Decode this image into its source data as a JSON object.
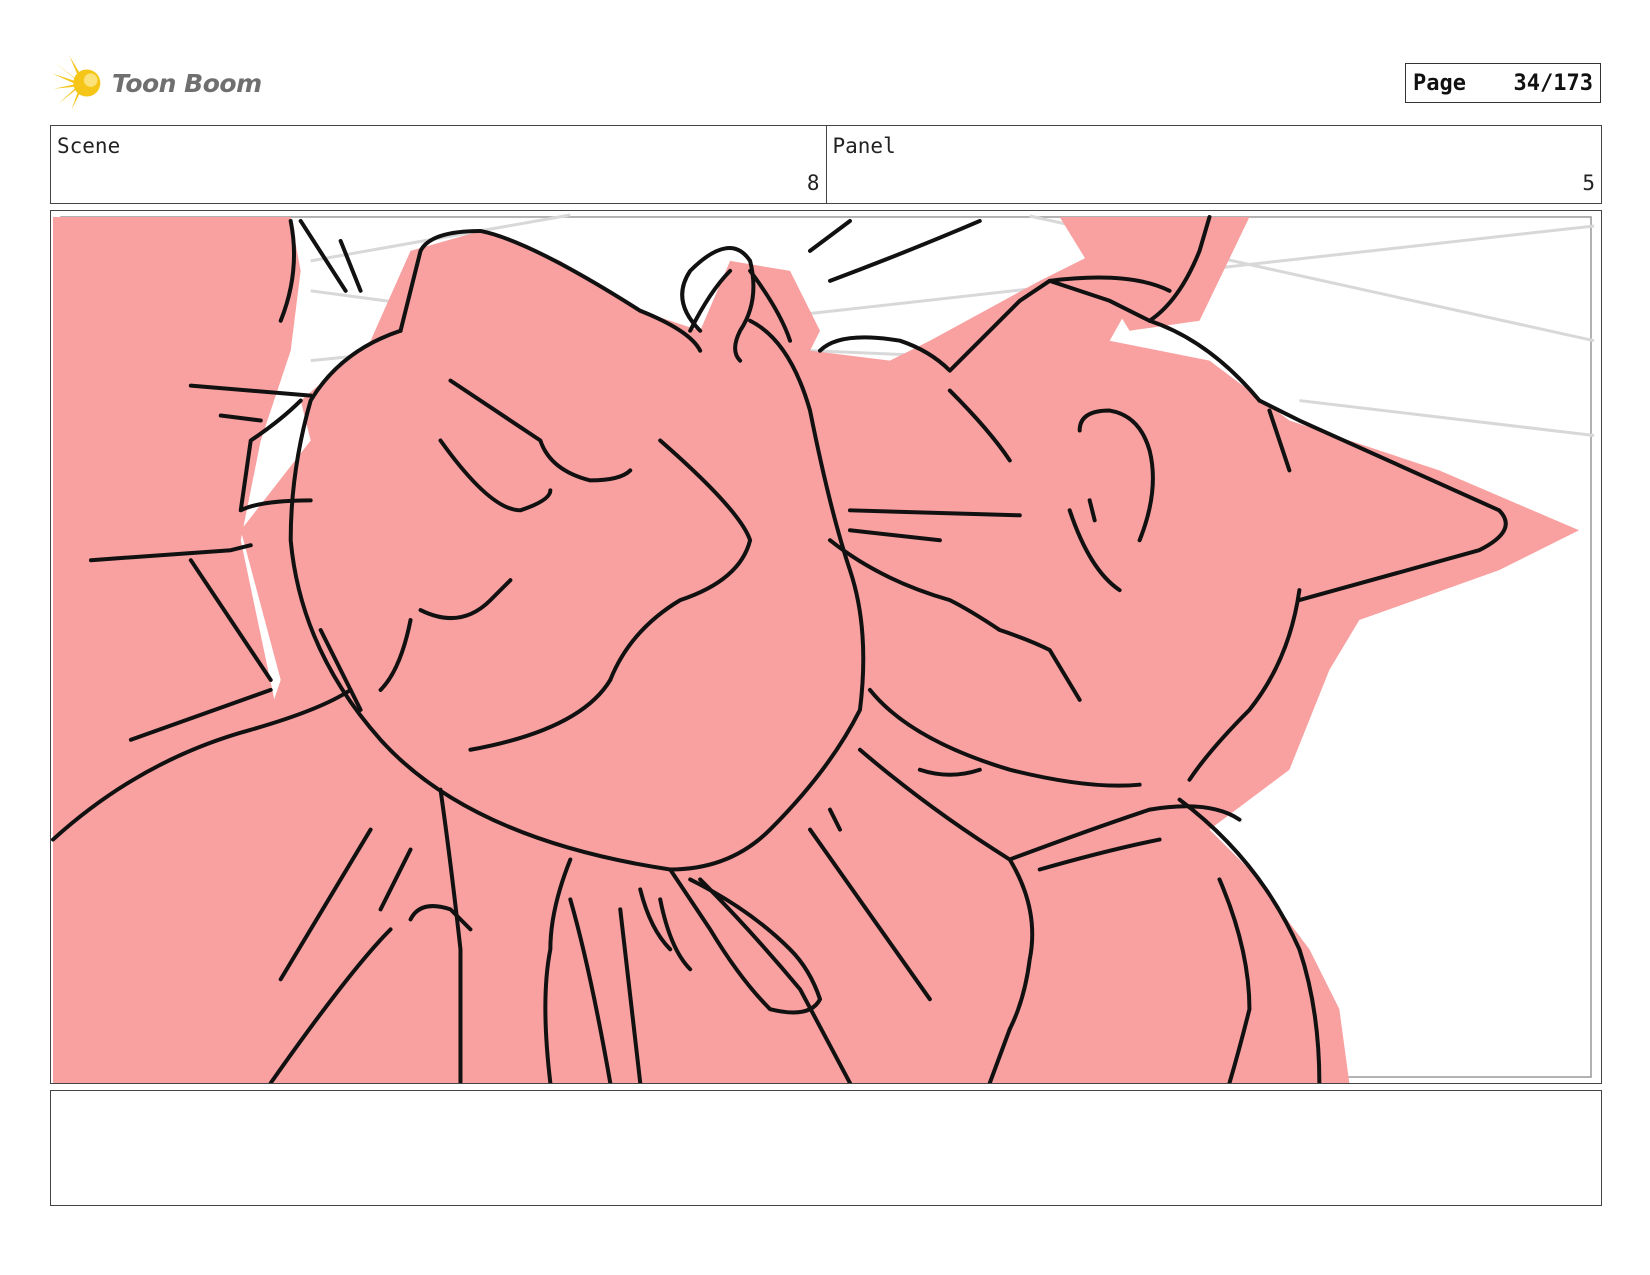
{
  "header": {
    "logo_text": "Toon Boom",
    "logo_icon": "starburst-icon",
    "page_label": "Page",
    "page_number": "34/173"
  },
  "info": {
    "scene_label": "Scene",
    "scene_value": "8",
    "panel_label": "Panel",
    "panel_value": "5"
  },
  "colors": {
    "fill_pink": "#f9a0a0",
    "ink": "#111111",
    "logo_yellow": "#f5c518",
    "logo_text_gray": "#6f6f6f"
  },
  "notes": {
    "text": ""
  }
}
